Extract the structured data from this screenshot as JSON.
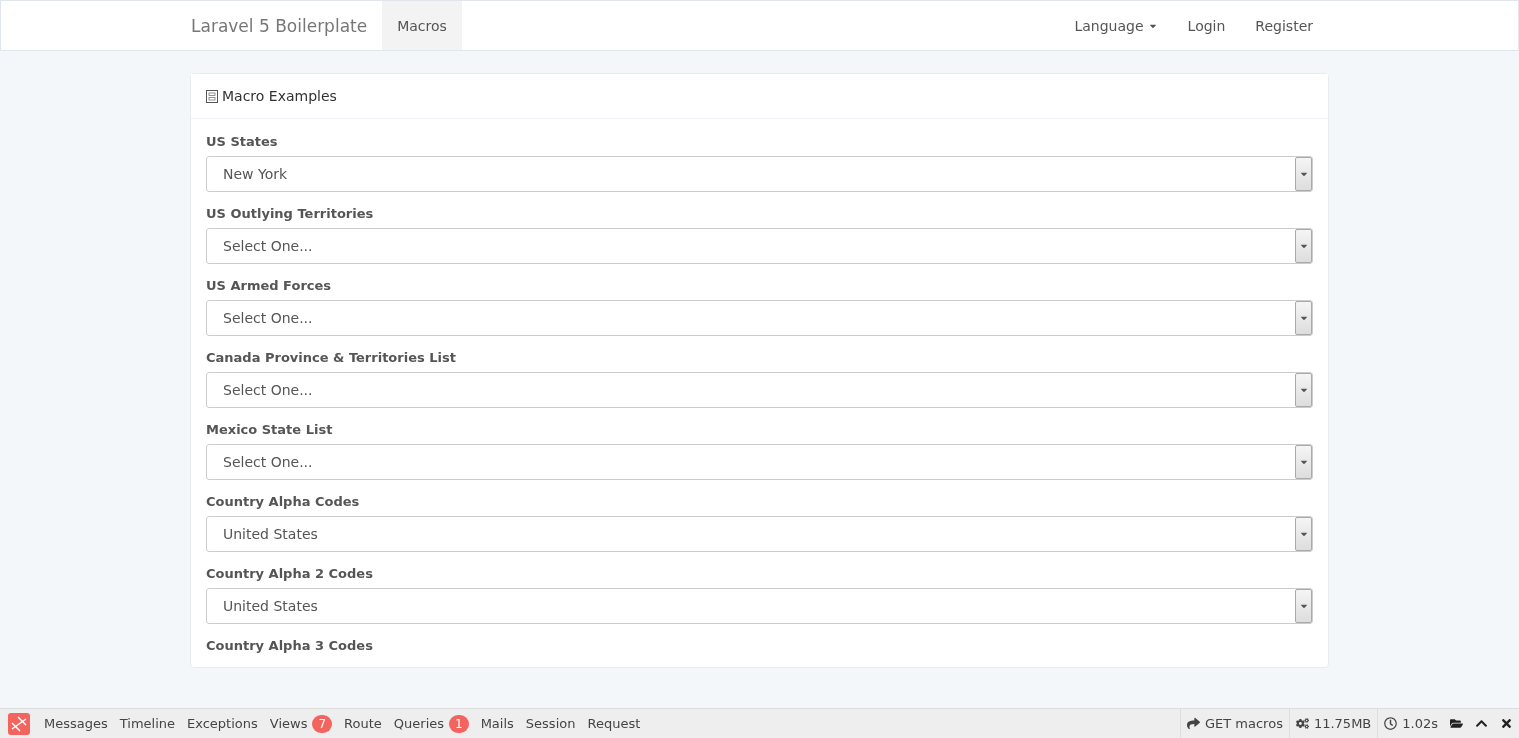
{
  "navbar": {
    "brand": "Laravel 5 Boilerplate",
    "links": [
      {
        "label": "Macros",
        "selected": true
      }
    ],
    "right": [
      {
        "label": "Language",
        "kind": "dropdown"
      },
      {
        "label": "Login",
        "kind": "link"
      },
      {
        "label": "Register",
        "kind": "link"
      }
    ]
  },
  "panel": {
    "title": "Macro Examples",
    "fields": [
      {
        "label": "US States",
        "value": "New York"
      },
      {
        "label": "US Outlying Territories",
        "value": "Select One..."
      },
      {
        "label": "US Armed Forces",
        "value": "Select One..."
      },
      {
        "label": "Canada Province & Territories List",
        "value": "Select One..."
      },
      {
        "label": "Mexico State List",
        "value": "Select One..."
      },
      {
        "label": "Country Alpha Codes",
        "value": "United States"
      },
      {
        "label": "Country Alpha 2 Codes",
        "value": "United States"
      },
      {
        "label": "Country Alpha 3 Codes"
      }
    ]
  },
  "debugbar": {
    "tabs": [
      {
        "label": "Messages"
      },
      {
        "label": "Timeline"
      },
      {
        "label": "Exceptions"
      },
      {
        "label": "Views",
        "badge": "7"
      },
      {
        "label": "Route"
      },
      {
        "label": "Queries",
        "badge": "1"
      },
      {
        "label": "Mails"
      },
      {
        "label": "Session"
      },
      {
        "label": "Request"
      }
    ],
    "indicators": [
      {
        "kind": "route",
        "text": "GET macros"
      },
      {
        "kind": "memory",
        "text": "11.75MB"
      },
      {
        "kind": "time",
        "text": "1.02s"
      }
    ]
  }
}
